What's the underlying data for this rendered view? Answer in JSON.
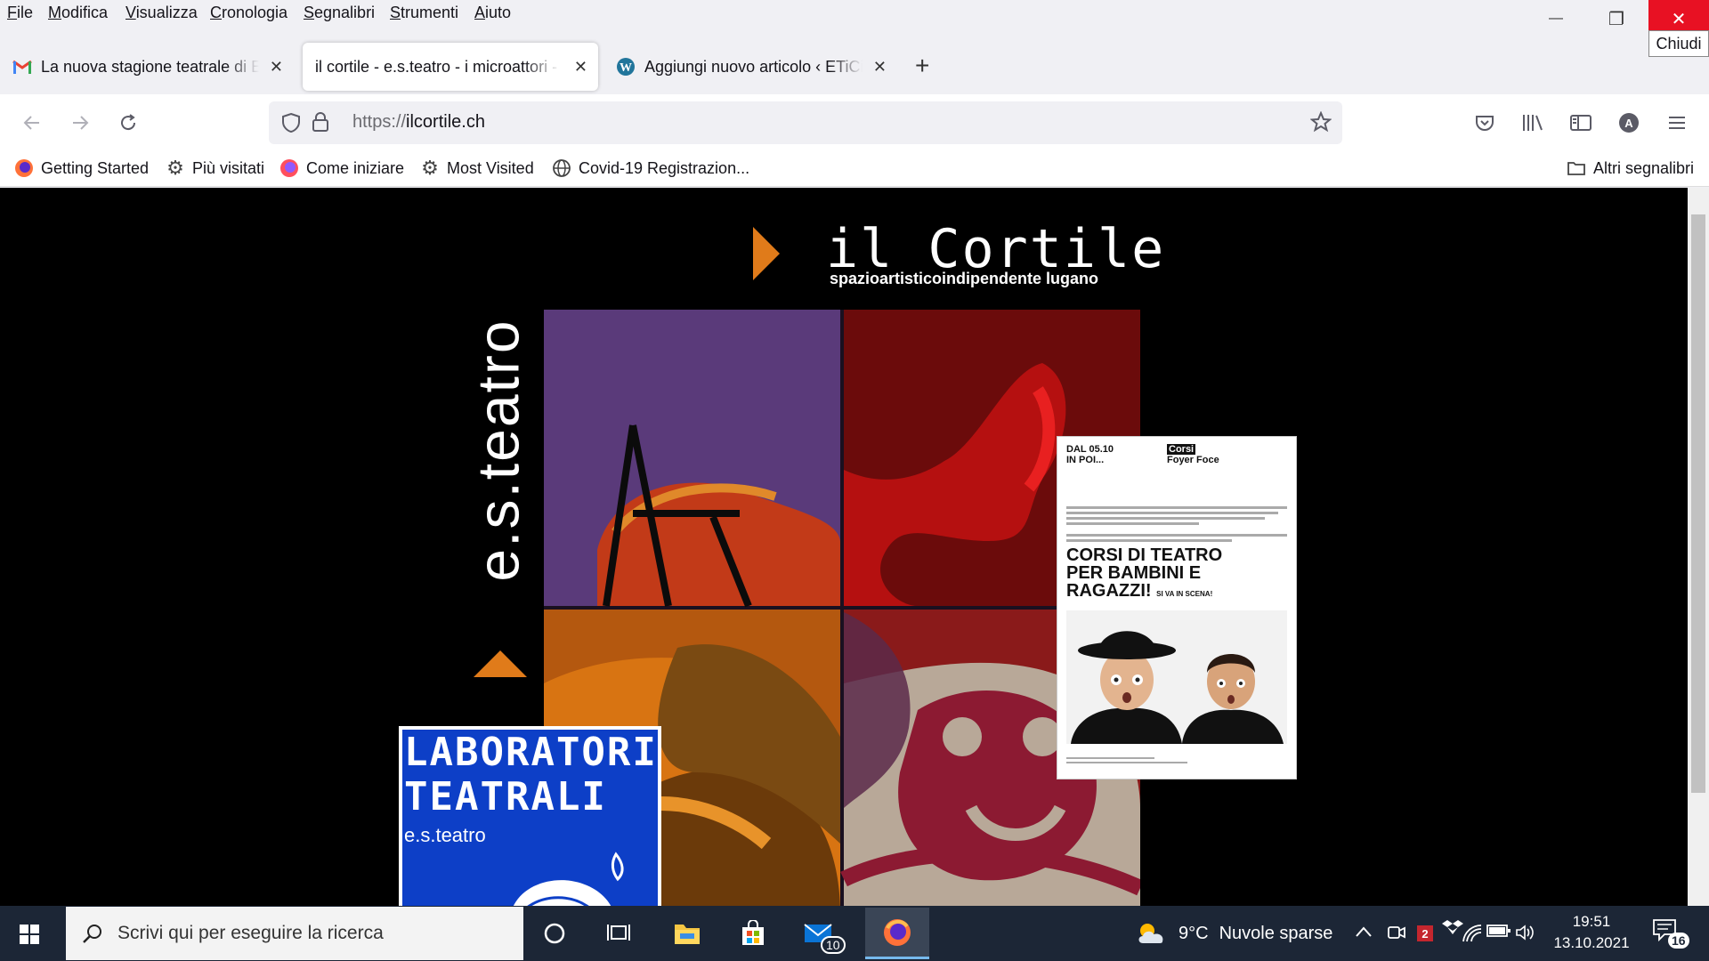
{
  "menu": {
    "items": [
      {
        "ul": "F",
        "rest": "ile"
      },
      {
        "ul": "M",
        "rest": "odifica"
      },
      {
        "ul": "V",
        "rest": "isualizza"
      },
      {
        "ul": "C",
        "rest": "ronologia"
      },
      {
        "ul": "S",
        "rest": "egnalibri"
      },
      {
        "ul": "S",
        "rest": "trumenti"
      },
      {
        "ul": "A",
        "rest": "iuto"
      }
    ]
  },
  "window": {
    "minimize": "—",
    "restore": "❐",
    "close": "✕",
    "close_tooltip": "Chiudi"
  },
  "tabs": [
    {
      "title": "La nuova stagione teatrale di En",
      "icon": "gmail-icon"
    },
    {
      "title": "il cortile - e.s.teatro - i microattori -",
      "icon": "none"
    },
    {
      "title": "Aggiungi nuovo articolo ‹ ETiCin",
      "icon": "wordpress-icon"
    }
  ],
  "tab_close": "✕",
  "new_tab": "+",
  "urlbar": {
    "protocol": "https://",
    "host": "ilcortile.ch"
  },
  "bookmarks": {
    "items": [
      {
        "label": "Getting Started",
        "icon": "firefox-icon"
      },
      {
        "label": "Più visitati",
        "icon": "gear-icon"
      },
      {
        "label": "Come iniziare",
        "icon": "firefox-icon"
      },
      {
        "label": "Most Visited",
        "icon": "gear-icon"
      },
      {
        "label": "Covid-19 Registrazion...",
        "icon": "globe-icon"
      }
    ],
    "other": "Altri segnalibri"
  },
  "site": {
    "logo_title": "il Cortile",
    "logo_subtitle": "spazioartisticoindipendente lugano",
    "vertical_brand": "e.s.teatro",
    "lab_card": {
      "line1": "LABORATORI",
      "line2": "TEATRALI",
      "sub": "e.s.teatro"
    },
    "poster": {
      "date1": "DAL 05.10",
      "date2": "IN POI...",
      "cat1": "Corsi",
      "cat2": "Foyer Foce",
      "title1": "CORSI DI TEATRO",
      "title2": "PER BAMBINI E",
      "title3": "RAGAZZI!",
      "tag": "SI VA IN SCENA!"
    }
  },
  "taskbar": {
    "search_placeholder": "Scrivi qui per eseguire la ricerca",
    "mail_badge": "10",
    "weather_temp": "9°C",
    "weather_desc": "Nuvole sparse",
    "time": "19:51",
    "date": "13.10.2021",
    "notif_count": "16",
    "tray_badge": "2"
  },
  "colors": {
    "accent_orange": "#e07b1a",
    "purple": "#5a3a7a",
    "maroon": "#6b0b0b",
    "lab_blue": "#0d3fc7",
    "close_red": "#e81123"
  }
}
